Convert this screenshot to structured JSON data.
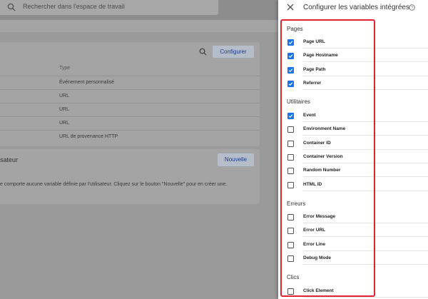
{
  "workspace": {
    "search_placeholder": "Rechercher dans l'espace de travail",
    "builtin_card": {
      "configure_label": "Configurer",
      "column_type": "Type",
      "rows": [
        {
          "type": "Événement personnalisé"
        },
        {
          "type": "URL"
        },
        {
          "type": "URL"
        },
        {
          "type": "URL"
        },
        {
          "type": "URL de provenance HTTP"
        }
      ]
    },
    "user_card": {
      "title": "sateur",
      "new_label": "Nouvelle",
      "empty_message": "e comporte aucune variable définie par l'utilisateur. Cliquez sur le bouton \"Nouvelle\" pour en créer une."
    }
  },
  "panel": {
    "title": "Configurer les variables intégrées",
    "sections": [
      {
        "title": "Pages",
        "items": [
          {
            "label": "Page URL",
            "checked": true
          },
          {
            "label": "Page Hostname",
            "checked": true
          },
          {
            "label": "Page Path",
            "checked": true
          },
          {
            "label": "Referrer",
            "checked": true
          }
        ]
      },
      {
        "title": "Utilitaires",
        "items": [
          {
            "label": "Event",
            "checked": true
          },
          {
            "label": "Environment Name",
            "checked": false
          },
          {
            "label": "Container ID",
            "checked": false
          },
          {
            "label": "Container Version",
            "checked": false
          },
          {
            "label": "Random Number",
            "checked": false
          },
          {
            "label": "HTML ID",
            "checked": false
          }
        ]
      },
      {
        "title": "Erreurs",
        "items": [
          {
            "label": "Error Message",
            "checked": false
          },
          {
            "label": "Error URL",
            "checked": false
          },
          {
            "label": "Error Line",
            "checked": false
          },
          {
            "label": "Debug Mode",
            "checked": false
          }
        ]
      },
      {
        "title": "Clics",
        "items": [
          {
            "label": "Click Element",
            "checked": false
          }
        ]
      }
    ]
  },
  "colors": {
    "accent": "#1a73e8",
    "highlight_border": "#e0232e"
  }
}
